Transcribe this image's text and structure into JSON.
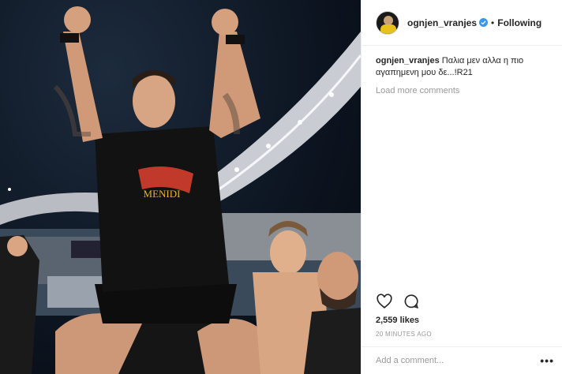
{
  "header": {
    "username": "ognjen_vranjes",
    "separator": "•",
    "follow_status": "Following"
  },
  "caption": {
    "username": "ognjen_vranjes",
    "text": "Παλια μεν αλλα η πιο αγαπημενη μου δε...!R21"
  },
  "load_more_label": "Load more comments",
  "likes": "2,559 likes",
  "time": "20 MINUTES AGO",
  "comment_input": {
    "placeholder": "Add a comment...",
    "value": ""
  },
  "more_label": "•••",
  "photo": {
    "shirt_text": "MENIDI"
  },
  "icons": {
    "like": "heart-icon",
    "comment": "speech-bubble-icon",
    "verified": "verified-badge-icon",
    "more": "more-options-icon"
  },
  "colors": {
    "verified": "#3897f0",
    "text": "#262626",
    "muted": "#999999"
  }
}
